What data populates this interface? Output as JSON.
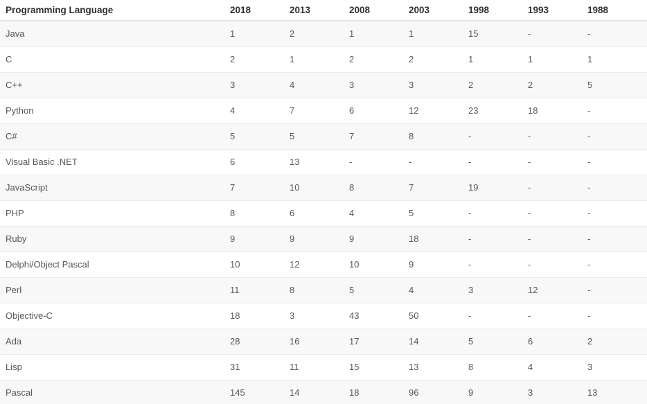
{
  "table": {
    "columns": [
      "Programming Language",
      "2018",
      "2013",
      "2008",
      "2003",
      "1998",
      "1993",
      "1988"
    ],
    "rows": [
      {
        "language": "Java",
        "values": [
          "1",
          "2",
          "1",
          "1",
          "15",
          "-",
          "-"
        ]
      },
      {
        "language": "C",
        "values": [
          "2",
          "1",
          "2",
          "2",
          "1",
          "1",
          "1"
        ]
      },
      {
        "language": "C++",
        "values": [
          "3",
          "4",
          "3",
          "3",
          "2",
          "2",
          "5"
        ]
      },
      {
        "language": "Python",
        "values": [
          "4",
          "7",
          "6",
          "12",
          "23",
          "18",
          "-"
        ]
      },
      {
        "language": "C#",
        "values": [
          "5",
          "5",
          "7",
          "8",
          "-",
          "-",
          "-"
        ]
      },
      {
        "language": "Visual Basic .NET",
        "values": [
          "6",
          "13",
          "-",
          "-",
          "-",
          "-",
          "-"
        ]
      },
      {
        "language": "JavaScript",
        "values": [
          "7",
          "10",
          "8",
          "7",
          "19",
          "-",
          "-"
        ]
      },
      {
        "language": "PHP",
        "values": [
          "8",
          "6",
          "4",
          "5",
          "-",
          "-",
          "-"
        ]
      },
      {
        "language": "Ruby",
        "values": [
          "9",
          "9",
          "9",
          "18",
          "-",
          "-",
          "-"
        ]
      },
      {
        "language": "Delphi/Object Pascal",
        "values": [
          "10",
          "12",
          "10",
          "9",
          "-",
          "-",
          "-"
        ]
      },
      {
        "language": "Perl",
        "values": [
          "11",
          "8",
          "5",
          "4",
          "3",
          "12",
          "-"
        ]
      },
      {
        "language": "Objective-C",
        "values": [
          "18",
          "3",
          "43",
          "50",
          "-",
          "-",
          "-"
        ]
      },
      {
        "language": "Ada",
        "values": [
          "28",
          "16",
          "17",
          "14",
          "5",
          "6",
          "2"
        ]
      },
      {
        "language": "Lisp",
        "values": [
          "31",
          "11",
          "15",
          "13",
          "8",
          "4",
          "3"
        ]
      },
      {
        "language": "Pascal",
        "values": [
          "145",
          "14",
          "18",
          "96",
          "9",
          "3",
          "13"
        ]
      }
    ]
  },
  "colors": {
    "header_text": "#2f2f2f",
    "body_text": "#575757",
    "stripe_bg": "#f8f8f8",
    "plain_bg": "#ffffff",
    "row_border": "#ececec",
    "header_border": "#e3e3e3"
  }
}
